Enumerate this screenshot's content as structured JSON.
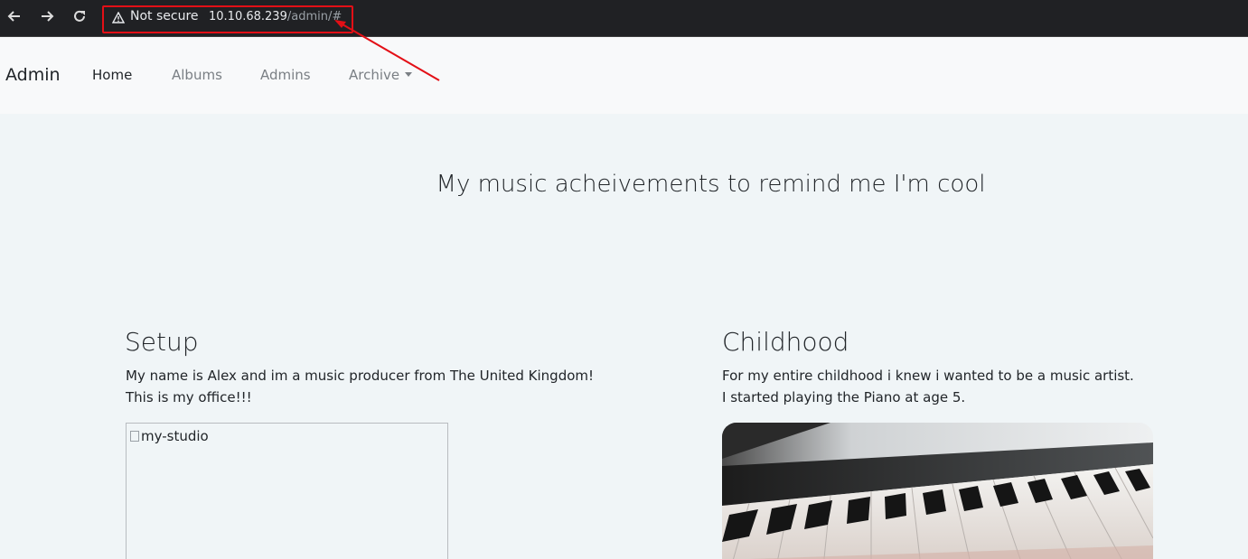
{
  "browser": {
    "security_text": "Not secure",
    "url_host": "10.10.68.239",
    "url_path": "/admin/#",
    "colors": {
      "chrome": "#202124",
      "annotation": "#e30f16"
    }
  },
  "navbar": {
    "brand": "Admin",
    "items": [
      {
        "label": "Home",
        "active": true
      },
      {
        "label": "Albums",
        "active": false
      },
      {
        "label": "Admins",
        "active": false
      },
      {
        "label": "Archive",
        "active": false,
        "dropdown": true
      }
    ]
  },
  "main": {
    "title": "My music acheivements to remind me I'm cool",
    "sections": [
      {
        "heading": "Setup",
        "lines": [
          "My name is Alex and im a music producer from The United Kingdom!",
          "This is my office!!!"
        ],
        "image_alt": "my-studio",
        "image_loaded": false
      },
      {
        "heading": "Childhood",
        "lines": [
          "For my entire childhood i knew i wanted to be a music artist.",
          "I started playing the Piano at age 5."
        ],
        "image_subject": "piano keys",
        "image_loaded": true
      }
    ]
  }
}
